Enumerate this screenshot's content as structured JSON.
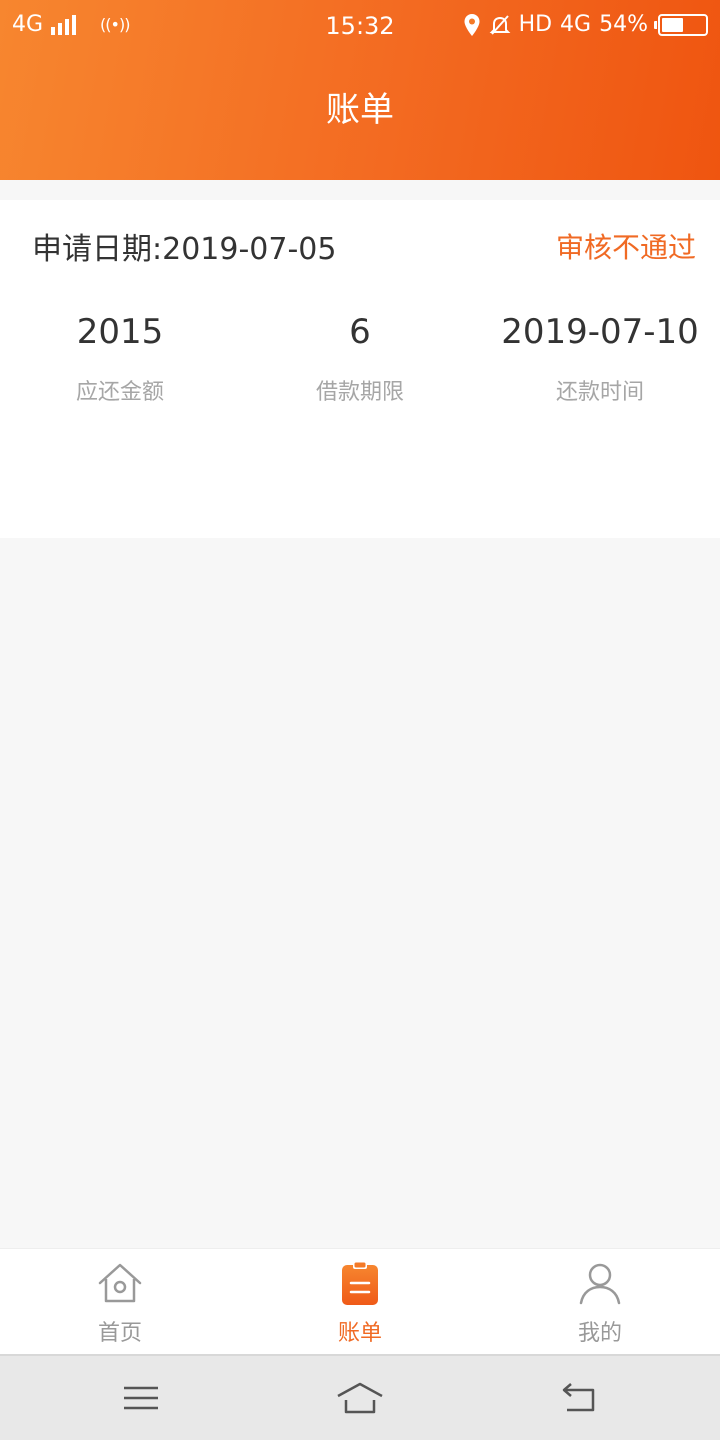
{
  "status_bar": {
    "network": "4G",
    "time": "15:32",
    "hd": "HD",
    "network_right": "4G",
    "battery": "54%",
    "battery_level": 0.54
  },
  "header": {
    "title": "账单"
  },
  "bill": {
    "apply_date": "申请日期:2019-07-05",
    "status": "审核不通过",
    "stats": [
      {
        "value": "2015",
        "label": "应还金额"
      },
      {
        "value": "6",
        "label": "借款期限"
      },
      {
        "value": "2019-07-10",
        "label": "还款时间"
      }
    ]
  },
  "tabbar": {
    "items": [
      {
        "label": "首页",
        "icon": "home-icon",
        "active": false
      },
      {
        "label": "账单",
        "icon": "bill-icon",
        "active": true
      },
      {
        "label": "我的",
        "icon": "profile-icon",
        "active": false
      }
    ]
  },
  "colors": {
    "accent": "#f06a24",
    "header_start": "#f7862f",
    "header_end": "#ef5510",
    "muted_text": "#a6a6a6"
  }
}
